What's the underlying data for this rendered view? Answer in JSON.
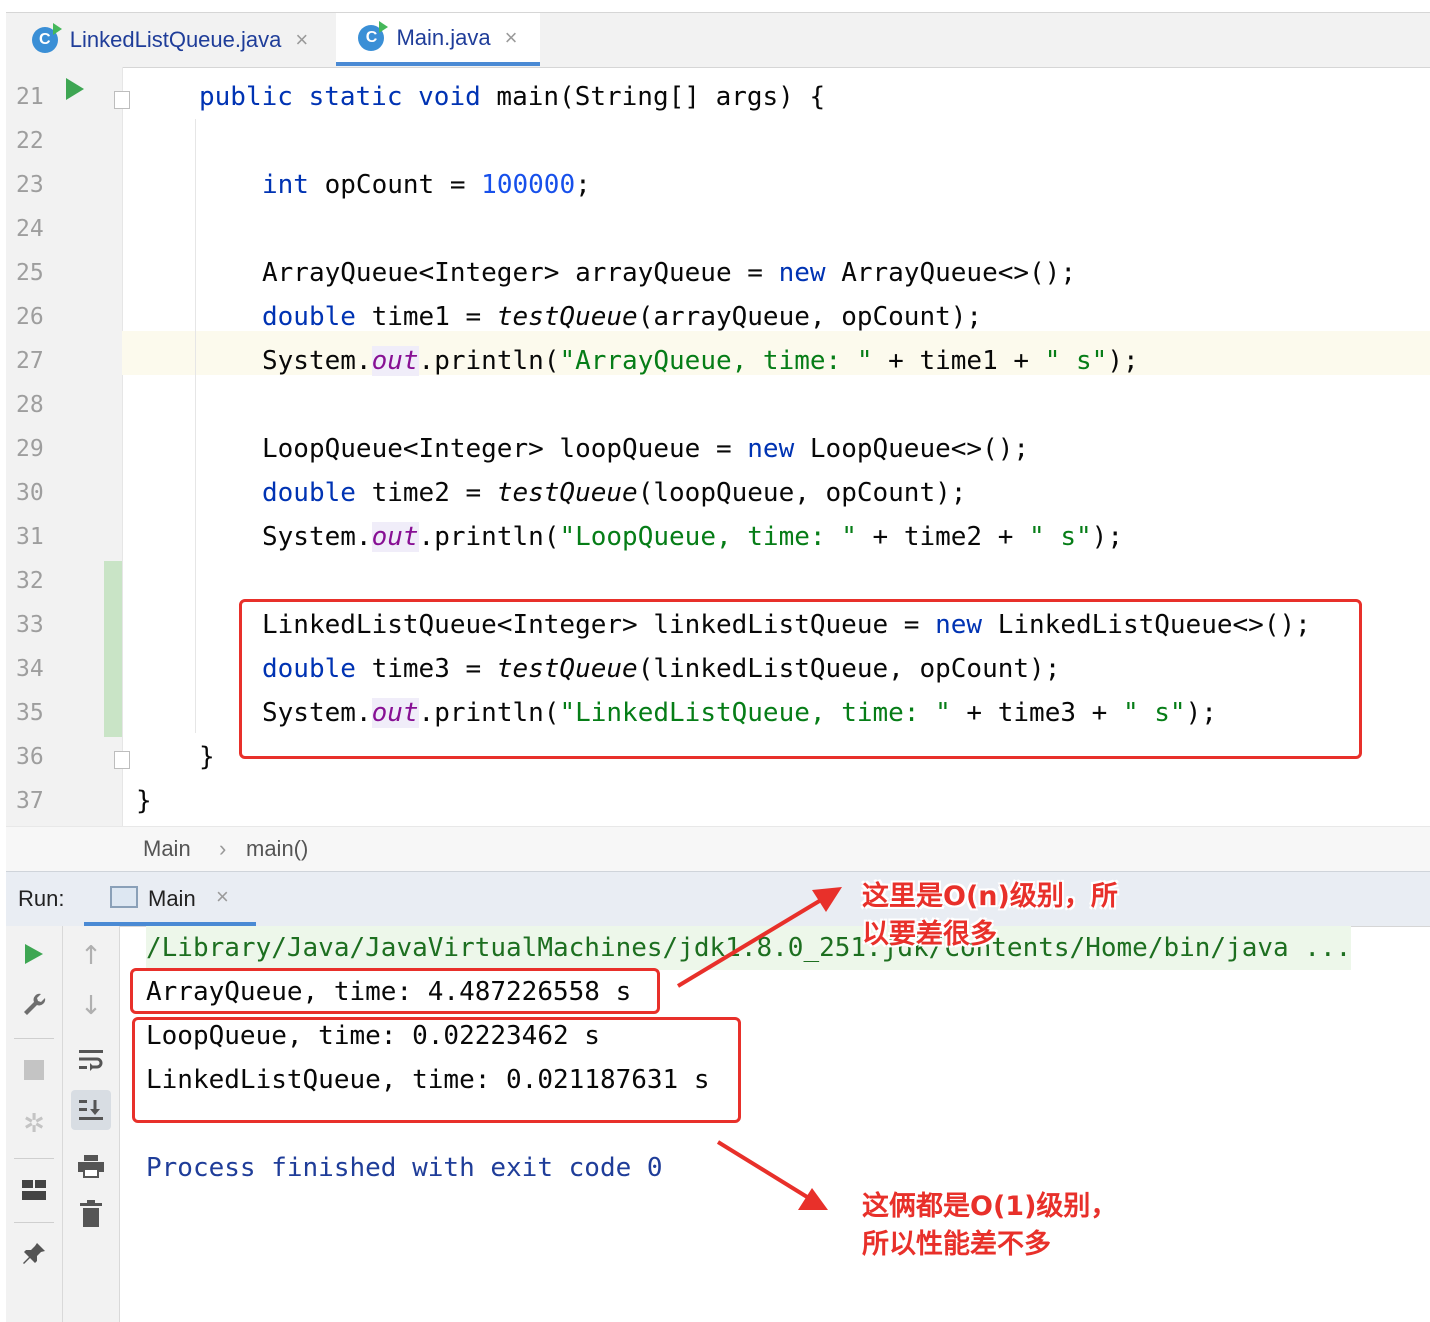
{
  "tabs": [
    {
      "label": "LinkedListQueue.java",
      "icon": "class-icon",
      "active": false
    },
    {
      "label": "Main.java",
      "icon": "class-icon",
      "active": true
    }
  ],
  "editor": {
    "lines": [
      {
        "n": "21",
        "tokens": [
          [
            "kw",
            "public static void "
          ],
          [
            "",
            "main(String[] args) {"
          ]
        ]
      },
      {
        "n": "22",
        "tokens": []
      },
      {
        "n": "23",
        "tokens": [
          [
            "kw",
            "int "
          ],
          [
            "",
            "opCount = "
          ],
          [
            "num",
            "100000"
          ],
          [
            "",
            ";"
          ]
        ]
      },
      {
        "n": "24",
        "tokens": []
      },
      {
        "n": "25",
        "tokens": [
          [
            "",
            "ArrayQueue<Integer> arrayQueue = "
          ],
          [
            "kw",
            "new "
          ],
          [
            "",
            "ArrayQueue<>();"
          ]
        ]
      },
      {
        "n": "26",
        "tokens": [
          [
            "kw",
            "double "
          ],
          [
            "",
            "time1 = "
          ],
          [
            "it",
            "testQueue"
          ],
          [
            "",
            "(arrayQueue, opCount);"
          ]
        ]
      },
      {
        "n": "27",
        "tokens": [
          [
            "",
            "System."
          ],
          [
            "fld",
            "out"
          ],
          [
            "",
            ".println("
          ],
          [
            "str",
            "\"ArrayQueue, time: \""
          ],
          [
            "",
            " + time1 + "
          ],
          [
            "str",
            "\" s\""
          ],
          [
            "",
            ");"
          ]
        ]
      },
      {
        "n": "28",
        "tokens": []
      },
      {
        "n": "29",
        "tokens": [
          [
            "",
            "LoopQueue<Integer> loopQueue = "
          ],
          [
            "kw",
            "new "
          ],
          [
            "",
            "LoopQueue<>();"
          ]
        ]
      },
      {
        "n": "30",
        "tokens": [
          [
            "kw",
            "double "
          ],
          [
            "",
            "time2 = "
          ],
          [
            "it",
            "testQueue"
          ],
          [
            "",
            "(loopQueue, opCount);"
          ]
        ]
      },
      {
        "n": "31",
        "tokens": [
          [
            "",
            "System."
          ],
          [
            "fld",
            "out"
          ],
          [
            "",
            ".println("
          ],
          [
            "str",
            "\"LoopQueue, time: \""
          ],
          [
            "",
            " + time2 + "
          ],
          [
            "str",
            "\" s\""
          ],
          [
            "",
            ");"
          ]
        ]
      },
      {
        "n": "32",
        "tokens": []
      },
      {
        "n": "33",
        "tokens": [
          [
            "",
            "LinkedListQueue<Integer> linkedListQueue = "
          ],
          [
            "kw",
            "new "
          ],
          [
            "",
            "LinkedListQueue<>();"
          ]
        ]
      },
      {
        "n": "34",
        "tokens": [
          [
            "kw",
            "double "
          ],
          [
            "",
            "time3 = "
          ],
          [
            "it",
            "testQueue"
          ],
          [
            "",
            "(linkedListQueue, opCount);"
          ]
        ]
      },
      {
        "n": "35",
        "tokens": [
          [
            "",
            "System."
          ],
          [
            "fld",
            "out"
          ],
          [
            "",
            ".println("
          ],
          [
            "str",
            "\"LinkedListQueue, time: \""
          ],
          [
            "",
            " + time3 + "
          ],
          [
            "str",
            "\" s\""
          ],
          [
            "",
            ");"
          ]
        ]
      },
      {
        "n": "36",
        "tokens": [
          [
            "",
            "}"
          ]
        ]
      },
      {
        "n": "37",
        "tokens": [
          [
            "",
            "}"
          ]
        ]
      }
    ]
  },
  "breadcrumb": {
    "class": "Main",
    "method": "main()"
  },
  "run": {
    "label": "Run:",
    "tab": "Main",
    "console": {
      "command": "/Library/Java/JavaVirtualMachines/jdk1.8.0_251.jdk/Contents/Home/bin/java ...",
      "out1": "ArrayQueue, time: 4.487226558 s",
      "out2": "LoopQueue, time: 0.02223462 s",
      "out3": "LinkedListQueue, time: 0.021187631 s",
      "exit": "Process finished with exit code 0"
    }
  },
  "annotations": {
    "note1_line1": "这里是O(n)级别，所",
    "note1_line2": "以要差很多",
    "note2_line1": "这俩都是O(1)级别，",
    "note2_line2": "所以性能差不多",
    "color": "#e8302a"
  }
}
